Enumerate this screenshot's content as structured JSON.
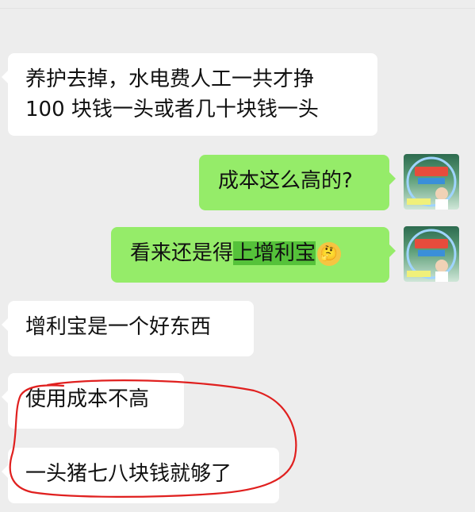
{
  "messages": [
    {
      "id": "m1",
      "direction": "incoming",
      "lines": [
        "养护去掉，水电费人工一共才挣",
        "100 块钱一头或者几十块钱一头"
      ]
    },
    {
      "id": "m2",
      "direction": "outgoing",
      "text": "成本这么高的?"
    },
    {
      "id": "m3",
      "direction": "outgoing",
      "text_before": "看来还是得",
      "highlight": "上增利宝",
      "emoji": "thinking-face"
    },
    {
      "id": "m4",
      "direction": "incoming",
      "text": "增利宝是一个好东西"
    },
    {
      "id": "m5",
      "direction": "incoming",
      "text": "使用成本不高"
    },
    {
      "id": "m6",
      "direction": "incoming",
      "text": "一头猪七八块钱就够了"
    }
  ],
  "colors": {
    "background": "#ededed",
    "incoming_bubble": "#ffffff",
    "outgoing_bubble": "#95ec69",
    "highlight": "#55c23a",
    "annotation": "#e0201f"
  }
}
